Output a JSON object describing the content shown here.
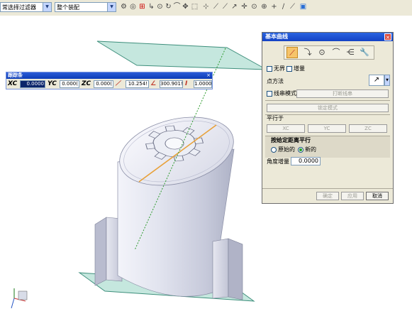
{
  "toolbar": {
    "filter_combo": "常选择过滤器",
    "assembly_combo": "整个装配"
  },
  "tracking_bar": {
    "title": "跟踪条",
    "xc_label": "XC",
    "yc_label": "YC",
    "zc_label": "ZC",
    "xc_value": "0.0000",
    "yc_value": "0.000(",
    "zc_value": "0.000(",
    "length_value": "10.254!",
    "angle_value": "300.901!",
    "offset_value": "1.0000"
  },
  "dialog": {
    "title": "基本曲线",
    "unbounded_label": "无界",
    "incremental_label": "增量",
    "point_method_label": "点方法",
    "string_mode_label": "线串模式",
    "break_string_button": "打断线串",
    "lock_mode_button": "锁定模式",
    "parallel_to_label": "平行于",
    "xc_button": "XC",
    "yc_button": "YC",
    "zc_button": "ZC",
    "offset_parallel_title": "按给定距离平行",
    "original_label": "原始的",
    "new_label": "新的",
    "angle_increment_label": "角度增量",
    "angle_increment_value": "0.0000",
    "ok_button": "确定",
    "apply_button": "应用",
    "cancel_button": "取消"
  },
  "colors": {
    "plane_fill": "#b7e1d6",
    "plane_edge": "#3e8f7c",
    "body_color": "#d9dbe8",
    "line_orange": "#e8a13a",
    "line_green": "#2c9a2c"
  }
}
